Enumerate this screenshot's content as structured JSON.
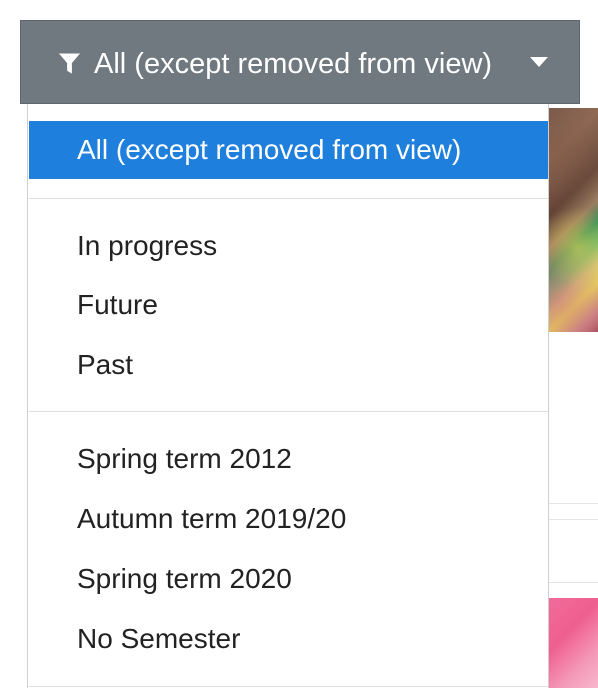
{
  "filter": {
    "button_label": "All (except removed from view)",
    "button_color": "#707880",
    "selected_color": "#1f7fdc",
    "icon_left": "filter-icon",
    "icon_right": "caret-down-icon"
  },
  "menu": {
    "items": [
      {
        "label": "All (except removed from view)",
        "selected": true
      },
      {
        "label": "In progress",
        "selected": false
      },
      {
        "label": "Future",
        "selected": false
      },
      {
        "label": "Past",
        "selected": false
      },
      {
        "label": "Spring term 2012",
        "selected": false
      },
      {
        "label": "Autumn term 2019/20",
        "selected": false
      },
      {
        "label": "Spring term 2020",
        "selected": false
      },
      {
        "label": "No Semester",
        "selected": false
      }
    ]
  }
}
